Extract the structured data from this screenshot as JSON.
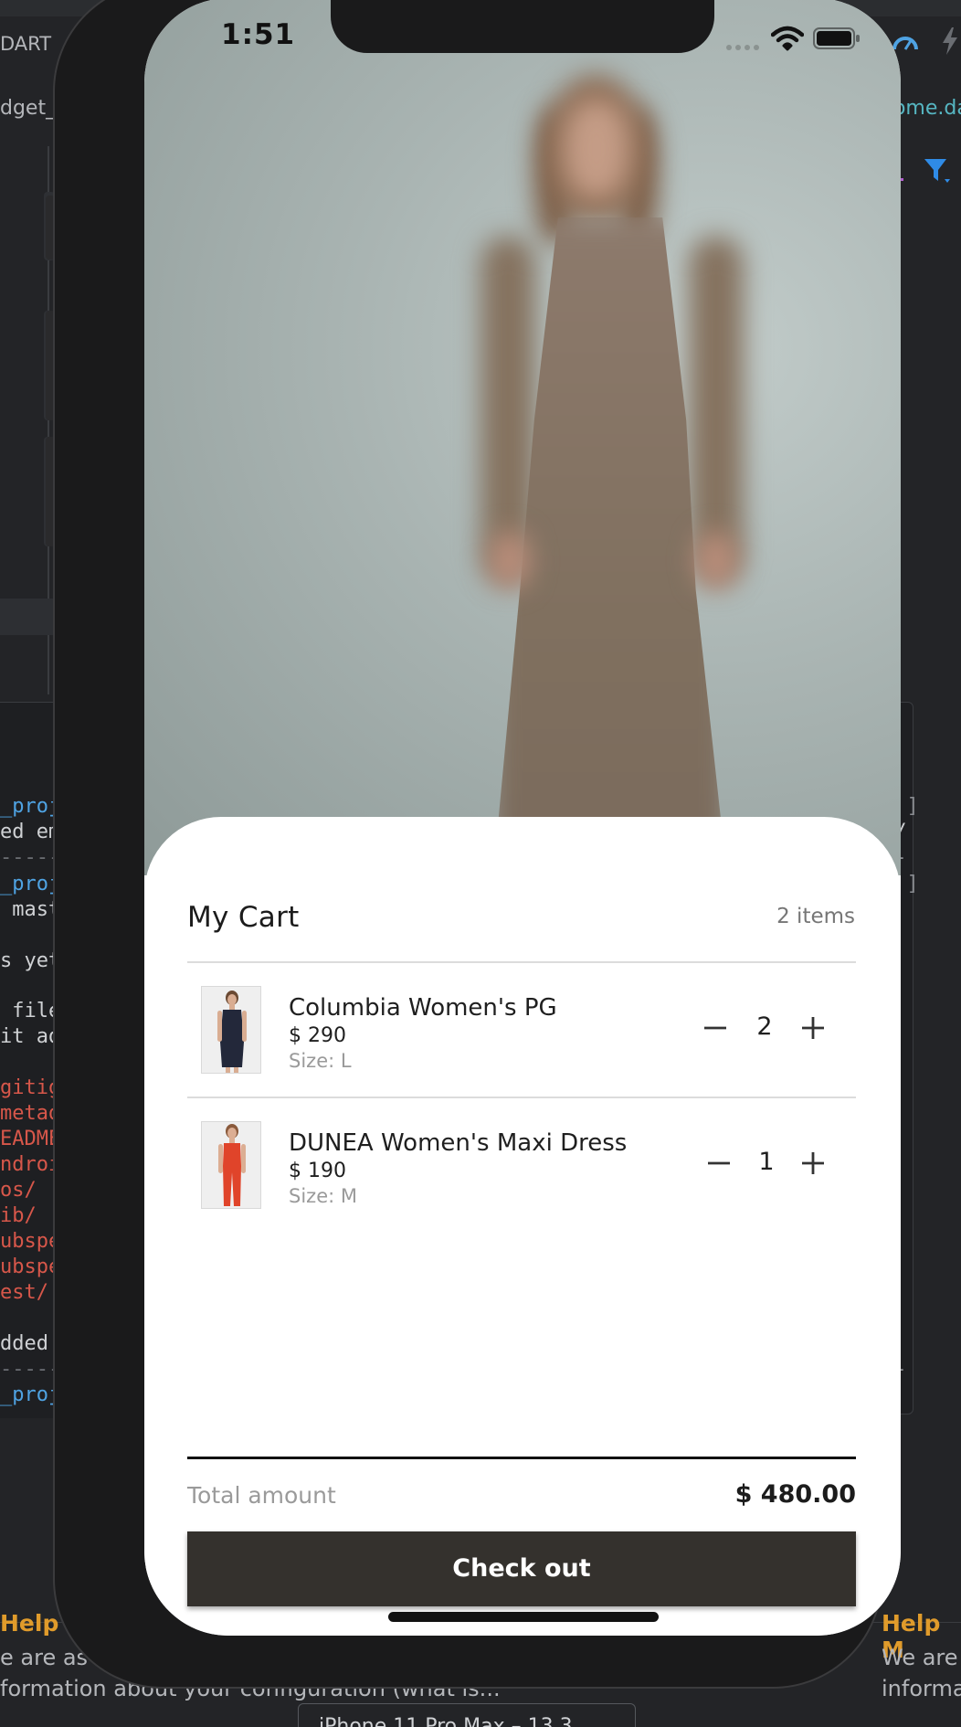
{
  "ide": {
    "tab_left": "DART",
    "left_file": "dget_",
    "right_file": "home.da",
    "left_terminal": [
      {
        "text": "_proj",
        "kind": "blue",
        "row": 0
      },
      {
        "text": "ed em",
        "kind": "white",
        "row": 1
      },
      {
        "text": "-----",
        "kind": "dim",
        "row": 2
      },
      {
        "text": "_proj",
        "kind": "blue",
        "row": 3
      },
      {
        "text": " mast",
        "kind": "white",
        "row": 4
      },
      {
        "text": "s yet",
        "kind": "white",
        "row": 5
      },
      {
        "text": " file",
        "kind": "white",
        "row": 6
      },
      {
        "text": "it ad",
        "kind": "white",
        "row": 7
      },
      {
        "text": "gitig",
        "kind": "red",
        "row": 8
      },
      {
        "text": "metad",
        "kind": "red",
        "row": 9
      },
      {
        "text": "EADME",
        "kind": "red",
        "row": 10
      },
      {
        "text": "ndroi",
        "kind": "red",
        "row": 11
      },
      {
        "text": "os/",
        "kind": "red",
        "row": 12
      },
      {
        "text": "ib/",
        "kind": "red",
        "row": 13
      },
      {
        "text": "ubspe",
        "kind": "red",
        "row": 14
      },
      {
        "text": "ubspe",
        "kind": "red",
        "row": 15
      },
      {
        "text": "est/",
        "kind": "red",
        "row": 16
      },
      {
        "text": "dded",
        "kind": "white",
        "row": 17
      },
      {
        "text": "-----",
        "kind": "dim",
        "row": 18
      },
      {
        "text": "_proj",
        "kind": "blue",
        "row": 19
      }
    ],
    "right_terminal": [
      {
        "text": "P ]",
        "kind": "dim"
      },
      {
        "text": "t/",
        "kind": "white"
      },
      {
        "text": "--",
        "kind": "dim"
      },
      {
        "text": "P ]",
        "kind": "dim"
      },
      {
        "text": "--",
        "kind": "dim"
      },
      {
        "text": "P",
        "kind": "dim"
      }
    ],
    "help_title": "Help M",
    "help_title_right": "Help M",
    "help_line1": "e are as",
    "help_line2": "formation about your configuration (what is...",
    "help_right_line1": "We are",
    "help_right_line2": "informa",
    "device_selector": "iPhone 11 Pro Max – 13.3",
    "right_plus": "+",
    "right_e": "e"
  },
  "status_bar": {
    "time": "1:51"
  },
  "cart": {
    "title": "My Cart",
    "count": "2 items",
    "items": [
      {
        "name": "Columbia Women's PG",
        "price": "$ 290",
        "size": "Size: L",
        "quantity": "2",
        "dress_color": "#23283a"
      },
      {
        "name": "DUNEA Women's Maxi Dress",
        "price": "$ 190",
        "size": "Size: M",
        "quantity": "1",
        "dress_color": "#e0442a"
      }
    ],
    "total_label": "Total amount",
    "total_value": "$ 480.00",
    "checkout_label": "Check out"
  },
  "colors": {
    "checkout_button": "#34312d",
    "ide_blue": "#4fa3e3",
    "ide_red": "#d7574a",
    "ide_help_orange": "#e09b2b"
  }
}
